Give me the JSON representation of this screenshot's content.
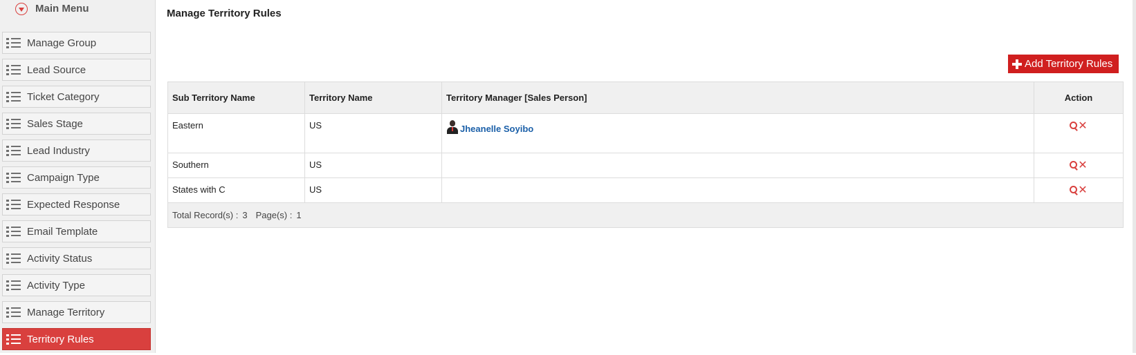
{
  "sidebar": {
    "title": "Main Menu",
    "items": [
      {
        "label": "Manage Group"
      },
      {
        "label": "Lead Source"
      },
      {
        "label": "Ticket Category"
      },
      {
        "label": "Sales Stage"
      },
      {
        "label": "Lead Industry"
      },
      {
        "label": "Campaign Type"
      },
      {
        "label": "Expected Response"
      },
      {
        "label": "Email Template"
      },
      {
        "label": "Activity Status"
      },
      {
        "label": "Activity Type"
      },
      {
        "label": "Manage Territory"
      },
      {
        "label": "Territory Rules",
        "active": true
      }
    ]
  },
  "page": {
    "title": "Manage Territory Rules",
    "add_button": "Add Territory Rules"
  },
  "table": {
    "headers": {
      "sub_territory": "Sub Territory Name",
      "territory": "Territory Name",
      "manager": "Territory Manager [Sales Person]",
      "action": "Action"
    },
    "rows": [
      {
        "sub_territory": "Eastern",
        "territory": "US",
        "manager": "Jheanelle Soyibo"
      },
      {
        "sub_territory": "Southern",
        "territory": "US",
        "manager": ""
      },
      {
        "sub_territory": "States with C",
        "territory": "US",
        "manager": ""
      }
    ],
    "footer": {
      "total_label": "Total Record(s) :",
      "total_value": "3",
      "pages_label": "Page(s) :",
      "pages_value": "1"
    }
  },
  "icons": {
    "menu_toggle": "chevron-down-circle-icon",
    "list": "list-icon",
    "add": "plus-icon",
    "view": "magnifier-icon",
    "delete": "close-icon",
    "person": "person-icon"
  },
  "colors": {
    "accent": "#d9403e",
    "add_button": "#d01f1f",
    "link": "#1a5fa8"
  }
}
